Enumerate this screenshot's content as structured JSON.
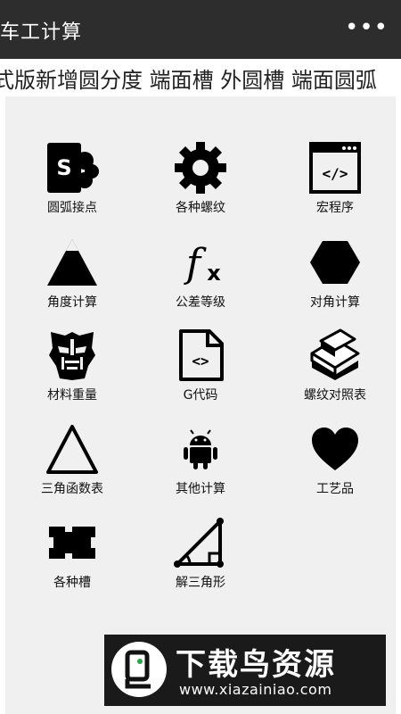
{
  "header": {
    "title": "车工计算",
    "more_label": "•••"
  },
  "marquee": {
    "text": "式版新增圆分度 端面槽 外圆槽 端面圆弧"
  },
  "grid": {
    "items": [
      {
        "label": "圆弧接点",
        "icon": "sharepoint-icon"
      },
      {
        "label": "各种螺纹",
        "icon": "gear-icon"
      },
      {
        "label": "宏程序",
        "icon": "code-window-icon"
      },
      {
        "label": "角度计算",
        "icon": "mountain-icon"
      },
      {
        "label": "公差等级",
        "icon": "function-icon"
      },
      {
        "label": "对角计算",
        "icon": "hexagon-icon"
      },
      {
        "label": "材料重量",
        "icon": "transformers-icon"
      },
      {
        "label": "G代码",
        "icon": "code-file-icon"
      },
      {
        "label": "螺纹对照表",
        "icon": "books-icon"
      },
      {
        "label": "三角函数表",
        "icon": "triangle-icon"
      },
      {
        "label": "其他计算",
        "icon": "android-icon"
      },
      {
        "label": "工艺品",
        "icon": "heart-icon"
      },
      {
        "label": "各种槽",
        "icon": "slot-icon"
      },
      {
        "label": "解三角形",
        "icon": "right-triangle-icon"
      }
    ]
  },
  "watermark": {
    "brand": "下载鸟资源",
    "url": "www.xiazainiao.com"
  }
}
